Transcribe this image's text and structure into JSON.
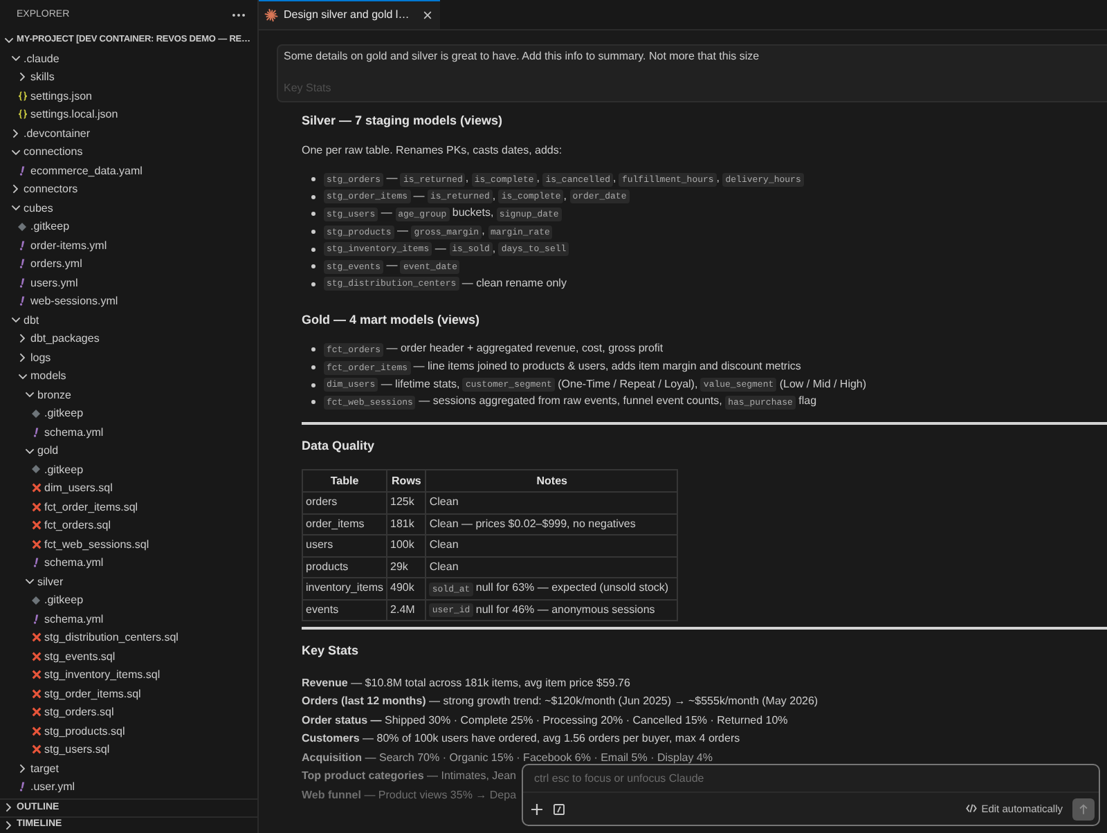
{
  "explorer": {
    "title": "EXPLORER",
    "root": {
      "label": "MY-PROJECT [DEV CONTAINER: REVOS DEMO — RE…",
      "expanded": true,
      "children": [
        {
          "name": ".claude",
          "kind": "folder",
          "expanded": true,
          "children": [
            {
              "name": "skills",
              "kind": "folder",
              "expanded": false
            },
            {
              "name": "settings.json",
              "kind": "json"
            },
            {
              "name": "settings.local.json",
              "kind": "json"
            }
          ]
        },
        {
          "name": ".devcontainer",
          "kind": "folder",
          "expanded": false
        },
        {
          "name": "connections",
          "kind": "folder",
          "expanded": true,
          "children": [
            {
              "name": "ecommerce_data.yaml",
              "kind": "yaml"
            }
          ]
        },
        {
          "name": "connectors",
          "kind": "folder",
          "expanded": false
        },
        {
          "name": "cubes",
          "kind": "folder",
          "expanded": true,
          "children": [
            {
              "name": ".gitkeep",
              "kind": "gitkeep"
            },
            {
              "name": "order-items.yml",
              "kind": "yaml"
            },
            {
              "name": "orders.yml",
              "kind": "yaml"
            },
            {
              "name": "users.yml",
              "kind": "yaml"
            },
            {
              "name": "web-sessions.yml",
              "kind": "yaml"
            }
          ]
        },
        {
          "name": "dbt",
          "kind": "folder",
          "expanded": true,
          "children": [
            {
              "name": "dbt_packages",
              "kind": "folder",
              "expanded": false
            },
            {
              "name": "logs",
              "kind": "folder",
              "expanded": false
            },
            {
              "name": "models",
              "kind": "folder",
              "expanded": true,
              "children": [
                {
                  "name": "bronze",
                  "kind": "folder",
                  "expanded": true,
                  "children": [
                    {
                      "name": ".gitkeep",
                      "kind": "gitkeep"
                    },
                    {
                      "name": "schema.yml",
                      "kind": "yaml"
                    }
                  ]
                },
                {
                  "name": "gold",
                  "kind": "folder",
                  "expanded": true,
                  "children": [
                    {
                      "name": ".gitkeep",
                      "kind": "gitkeep"
                    },
                    {
                      "name": "dim_users.sql",
                      "kind": "sql"
                    },
                    {
                      "name": "fct_order_items.sql",
                      "kind": "sql"
                    },
                    {
                      "name": "fct_orders.sql",
                      "kind": "sql"
                    },
                    {
                      "name": "fct_web_sessions.sql",
                      "kind": "sql"
                    },
                    {
                      "name": "schema.yml",
                      "kind": "yaml"
                    }
                  ]
                },
                {
                  "name": "silver",
                  "kind": "folder",
                  "expanded": true,
                  "children": [
                    {
                      "name": ".gitkeep",
                      "kind": "gitkeep"
                    },
                    {
                      "name": "schema.yml",
                      "kind": "yaml"
                    },
                    {
                      "name": "stg_distribution_centers.sql",
                      "kind": "sql"
                    },
                    {
                      "name": "stg_events.sql",
                      "kind": "sql"
                    },
                    {
                      "name": "stg_inventory_items.sql",
                      "kind": "sql"
                    },
                    {
                      "name": "stg_order_items.sql",
                      "kind": "sql"
                    },
                    {
                      "name": "stg_orders.sql",
                      "kind": "sql"
                    },
                    {
                      "name": "stg_products.sql",
                      "kind": "sql"
                    },
                    {
                      "name": "stg_users.sql",
                      "kind": "sql"
                    }
                  ]
                }
              ]
            },
            {
              "name": "target",
              "kind": "folder",
              "expanded": false
            },
            {
              "name": ".user.yml",
              "kind": "yaml"
            }
          ]
        }
      ]
    },
    "sections": [
      {
        "label": "OUTLINE",
        "expanded": false
      },
      {
        "label": "TIMELINE",
        "expanded": false
      }
    ]
  },
  "editor_tab": {
    "title": "Design silver and gold l…",
    "selected": true
  },
  "chat": {
    "user_message": {
      "text": "Some details on gold and silver is great to have. Add this info to summary. Not more that this size",
      "preview": "Key Stats"
    },
    "response": [
      {
        "kind": "heading",
        "text": "Silver — 7 staging models (views)"
      },
      {
        "kind": "paragraph",
        "text": "One per raw table. Renames PKs, casts dates, adds:"
      },
      {
        "kind": "list",
        "items": [
          {
            "parts": [
              {
                "kind": "code",
                "text": "stg_orders"
              },
              {
                "kind": "text",
                "text": " — "
              },
              {
                "kind": "code",
                "text": "is_returned"
              },
              {
                "kind": "text",
                "text": ", "
              },
              {
                "kind": "code",
                "text": "is_complete"
              },
              {
                "kind": "text",
                "text": ", "
              },
              {
                "kind": "code",
                "text": "is_cancelled"
              },
              {
                "kind": "text",
                "text": ", "
              },
              {
                "kind": "code",
                "text": "fulfillment_hours"
              },
              {
                "kind": "text",
                "text": ", "
              },
              {
                "kind": "code",
                "text": "delivery_hours"
              }
            ]
          },
          {
            "parts": [
              {
                "kind": "code",
                "text": "stg_order_items"
              },
              {
                "kind": "text",
                "text": " — "
              },
              {
                "kind": "code",
                "text": "is_returned"
              },
              {
                "kind": "text",
                "text": ", "
              },
              {
                "kind": "code",
                "text": "is_complete"
              },
              {
                "kind": "text",
                "text": ", "
              },
              {
                "kind": "code",
                "text": "order_date"
              }
            ]
          },
          {
            "parts": [
              {
                "kind": "code",
                "text": "stg_users"
              },
              {
                "kind": "text",
                "text": " — "
              },
              {
                "kind": "code",
                "text": "age_group"
              },
              {
                "kind": "text",
                "text": " buckets, "
              },
              {
                "kind": "code",
                "text": "signup_date"
              }
            ]
          },
          {
            "parts": [
              {
                "kind": "code",
                "text": "stg_products"
              },
              {
                "kind": "text",
                "text": " — "
              },
              {
                "kind": "code",
                "text": "gross_margin"
              },
              {
                "kind": "text",
                "text": ", "
              },
              {
                "kind": "code",
                "text": "margin_rate"
              }
            ]
          },
          {
            "parts": [
              {
                "kind": "code",
                "text": "stg_inventory_items"
              },
              {
                "kind": "text",
                "text": " — "
              },
              {
                "kind": "code",
                "text": "is_sold"
              },
              {
                "kind": "text",
                "text": ", "
              },
              {
                "kind": "code",
                "text": "days_to_sell"
              }
            ]
          },
          {
            "parts": [
              {
                "kind": "code",
                "text": "stg_events"
              },
              {
                "kind": "text",
                "text": " — "
              },
              {
                "kind": "code",
                "text": "event_date"
              }
            ]
          },
          {
            "parts": [
              {
                "kind": "code",
                "text": "stg_distribution_centers"
              },
              {
                "kind": "text",
                "text": " — clean rename only"
              }
            ]
          }
        ]
      },
      {
        "kind": "heading",
        "text": "Gold — 4 mart models (views)"
      },
      {
        "kind": "list",
        "items": [
          {
            "parts": [
              {
                "kind": "code",
                "text": "fct_orders"
              },
              {
                "kind": "text",
                "text": " — order header + aggregated revenue, cost, gross profit"
              }
            ]
          },
          {
            "parts": [
              {
                "kind": "code",
                "text": "fct_order_items"
              },
              {
                "kind": "text",
                "text": " — line items joined to products & users, adds item margin and discount metrics"
              }
            ]
          },
          {
            "parts": [
              {
                "kind": "code",
                "text": "dim_users"
              },
              {
                "kind": "text",
                "text": " — lifetime stats, "
              },
              {
                "kind": "code",
                "text": "customer_segment"
              },
              {
                "kind": "text",
                "text": " (One-Time / Repeat / Loyal), "
              },
              {
                "kind": "code",
                "text": "value_segment"
              },
              {
                "kind": "text",
                "text": " (Low / Mid / High)"
              }
            ]
          },
          {
            "parts": [
              {
                "kind": "code",
                "text": "fct_web_sessions"
              },
              {
                "kind": "text",
                "text": " — sessions aggregated from raw events, funnel event counts, "
              },
              {
                "kind": "code",
                "text": "has_purchase"
              },
              {
                "kind": "text",
                "text": " flag"
              }
            ]
          }
        ]
      },
      {
        "kind": "rule"
      },
      {
        "kind": "heading",
        "text": "Data Quality"
      },
      {
        "kind": "table",
        "columns": [
          "Table",
          "Rows",
          "Notes"
        ],
        "rows": [
          {
            "table": "orders",
            "rows": "125k",
            "notes": [
              {
                "kind": "text",
                "text": "Clean"
              }
            ]
          },
          {
            "table": "order_items",
            "rows": "181k",
            "notes": [
              {
                "kind": "text",
                "text": "Clean — prices $0.02–$999, no negatives"
              }
            ]
          },
          {
            "table": "users",
            "rows": "100k",
            "notes": [
              {
                "kind": "text",
                "text": "Clean"
              }
            ]
          },
          {
            "table": "products",
            "rows": "29k",
            "notes": [
              {
                "kind": "text",
                "text": "Clean"
              }
            ]
          },
          {
            "table": "inventory_items",
            "rows": "490k",
            "notes": [
              {
                "kind": "code",
                "text": "sold_at"
              },
              {
                "kind": "text",
                "text": " null for 63% — expected (unsold stock)"
              }
            ]
          },
          {
            "table": "events",
            "rows": "2.4M",
            "notes": [
              {
                "kind": "code",
                "text": "user_id"
              },
              {
                "kind": "text",
                "text": " null for 46% — anonymous sessions"
              }
            ]
          }
        ]
      },
      {
        "kind": "rule"
      },
      {
        "kind": "heading",
        "text": "Key Stats"
      },
      {
        "kind": "lines",
        "items": [
          "**Revenue** — $10.8M total across 181k items, avg item price $59.76",
          "**Orders (last 12 months)** — strong growth trend: ~$120k/month (Jun 2025) → ~$555k/month (May 2026)",
          "**Order status —** Shipped 30% · Complete 25% · Processing 20% · Cancelled 15% · Returned 10%",
          "**Customers** — 80% of 100k users have ordered, avg 1.56 orders per buyer, max 4 orders",
          "**Acquisition** — Search 70% · Organic 15% · Facebook 6% · Email 5% · Display 4%",
          "**Top product categories** — Intimates, Jean",
          "**Web funnel** — Product views 35% → Depa"
        ]
      }
    ]
  },
  "composer": {
    "placeholder": "ctrl esc to focus or unfocus Claude",
    "mode_label": "Edit automatically",
    "send_button": {
      "disabled": true
    }
  }
}
